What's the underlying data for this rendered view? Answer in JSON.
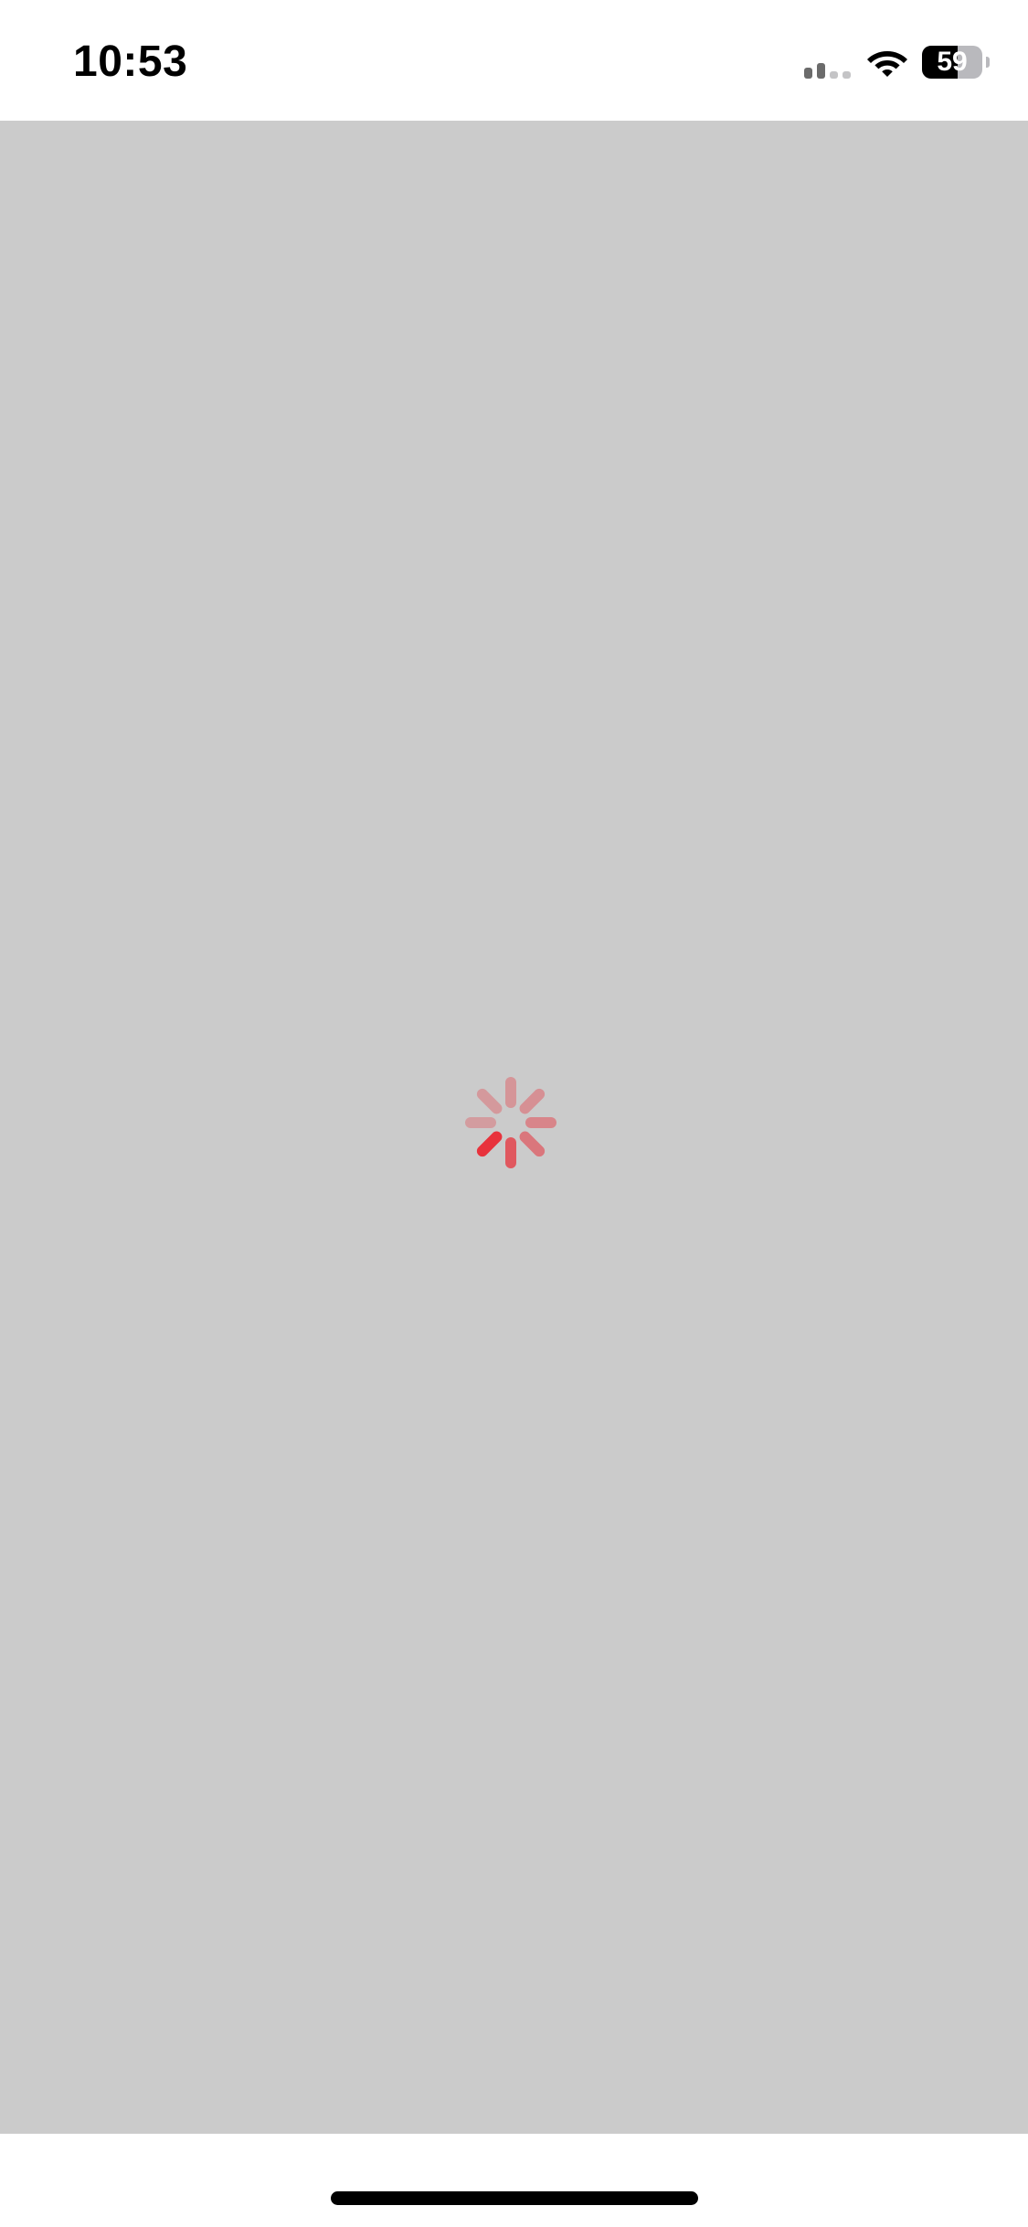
{
  "status_bar": {
    "time": "10:53",
    "battery_percent": "59",
    "battery_level": 0.59,
    "cell_signal_bars_active": 2,
    "cell_signal_bars_total": 4,
    "wifi_icon": "wifi-icon",
    "battery_icon": "battery-icon"
  },
  "content": {
    "background_color": "#cbcbcb",
    "loading_indicator": "activity-spinner-icon",
    "spinner_color": "#e8323c"
  }
}
